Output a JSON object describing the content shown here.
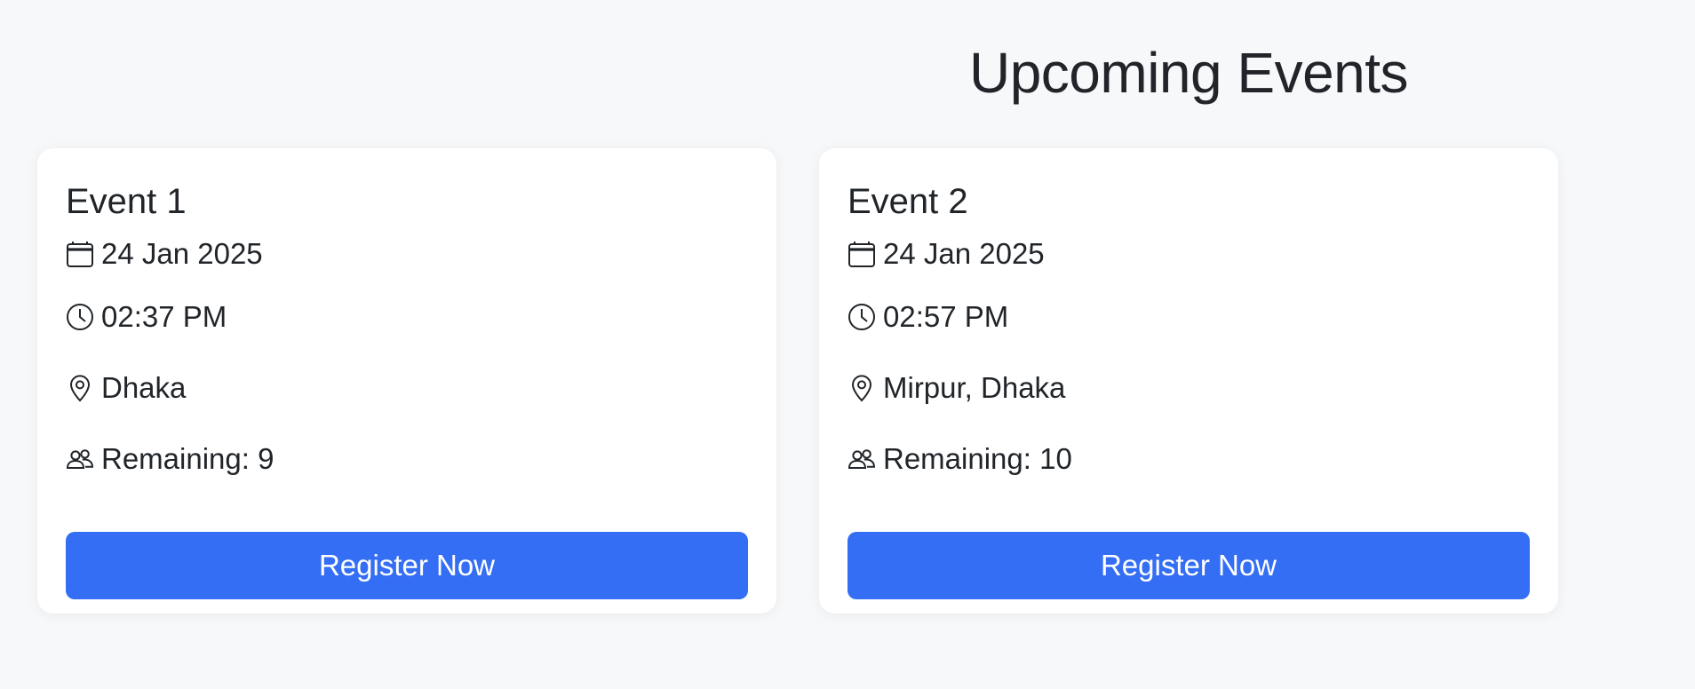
{
  "page": {
    "title": "Upcoming Events"
  },
  "events": [
    {
      "title": "Event 1",
      "date": "24 Jan 2025",
      "time": "02:37 PM",
      "location": "Dhaka",
      "remaining": "Remaining: 9",
      "button_label": "Register Now"
    },
    {
      "title": "Event 2",
      "date": "24 Jan 2025",
      "time": "02:57 PM",
      "location": "Mirpur, Dhaka",
      "remaining": "Remaining: 10",
      "button_label": "Register Now"
    }
  ],
  "icons": {
    "date": "calendar-icon",
    "time": "clock-icon",
    "location": "map-pin-icon",
    "remaining": "people-icon"
  },
  "colors": {
    "background": "#f7f8fa",
    "card": "#ffffff",
    "accent": "#346ef4",
    "text": "#212529"
  }
}
